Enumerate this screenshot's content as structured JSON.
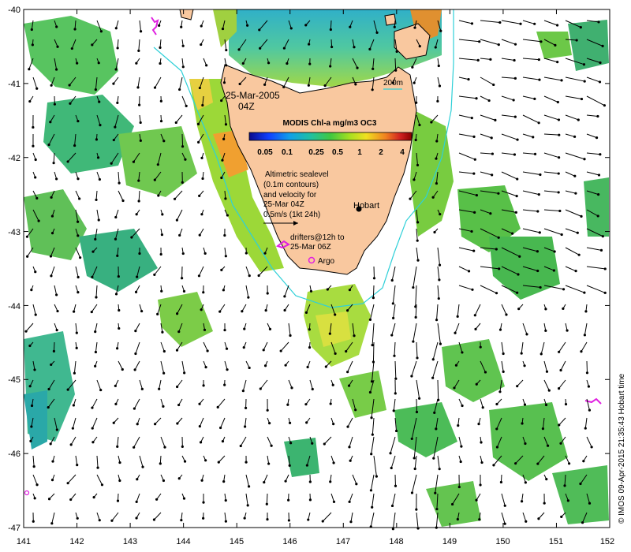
{
  "map": {
    "date_label": "25-Mar-2005",
    "time_label": "04Z",
    "colorbar": {
      "title": "MODIS Chl-a mg/m3 OC3",
      "ticks": [
        "0.05",
        "0.1",
        "0.25",
        "0.5",
        "1",
        "2",
        "4"
      ]
    },
    "altimetry_note": [
      "Altimetric sealevel",
      "(0.1m contours)",
      "and velocity for",
      "25-Mar 04Z"
    ],
    "velocity_scale_label": "0.5m/s (1kt 24h)",
    "drifters_note": [
      "drifters@12h to",
      "25-Mar 06Z"
    ],
    "argo_label": "Argo",
    "city_label": "Hobart",
    "isobath_label": "200m",
    "credit": "© IMOS 09-Apr-2015 21:35:43 Hobart time",
    "colors": {
      "land": "#f9c89f",
      "isobath": "#2fd0d8",
      "drifter": "#e020e0",
      "arrow": "#000000"
    }
  },
  "chart_data": {
    "type": "map",
    "x_axis": {
      "range": [
        141,
        152
      ],
      "ticks": [
        "141",
        "142",
        "143",
        "144",
        "145",
        "146",
        "147",
        "148",
        "149",
        "150",
        "151",
        "152"
      ]
    },
    "y_axis": {
      "range": [
        -47,
        -40
      ],
      "ticks": [
        "-40",
        "-41",
        "-42",
        "-43",
        "-44",
        "-45",
        "-46",
        "-47"
      ]
    },
    "chl_scale": "log",
    "chl_range": [
      0.05,
      4
    ],
    "features": [
      "chlorophyll-a",
      "sea-level-contours",
      "velocity-arrows",
      "200m-isobath",
      "drifter-tracks",
      "argo-float",
      "hobart-marker"
    ]
  }
}
